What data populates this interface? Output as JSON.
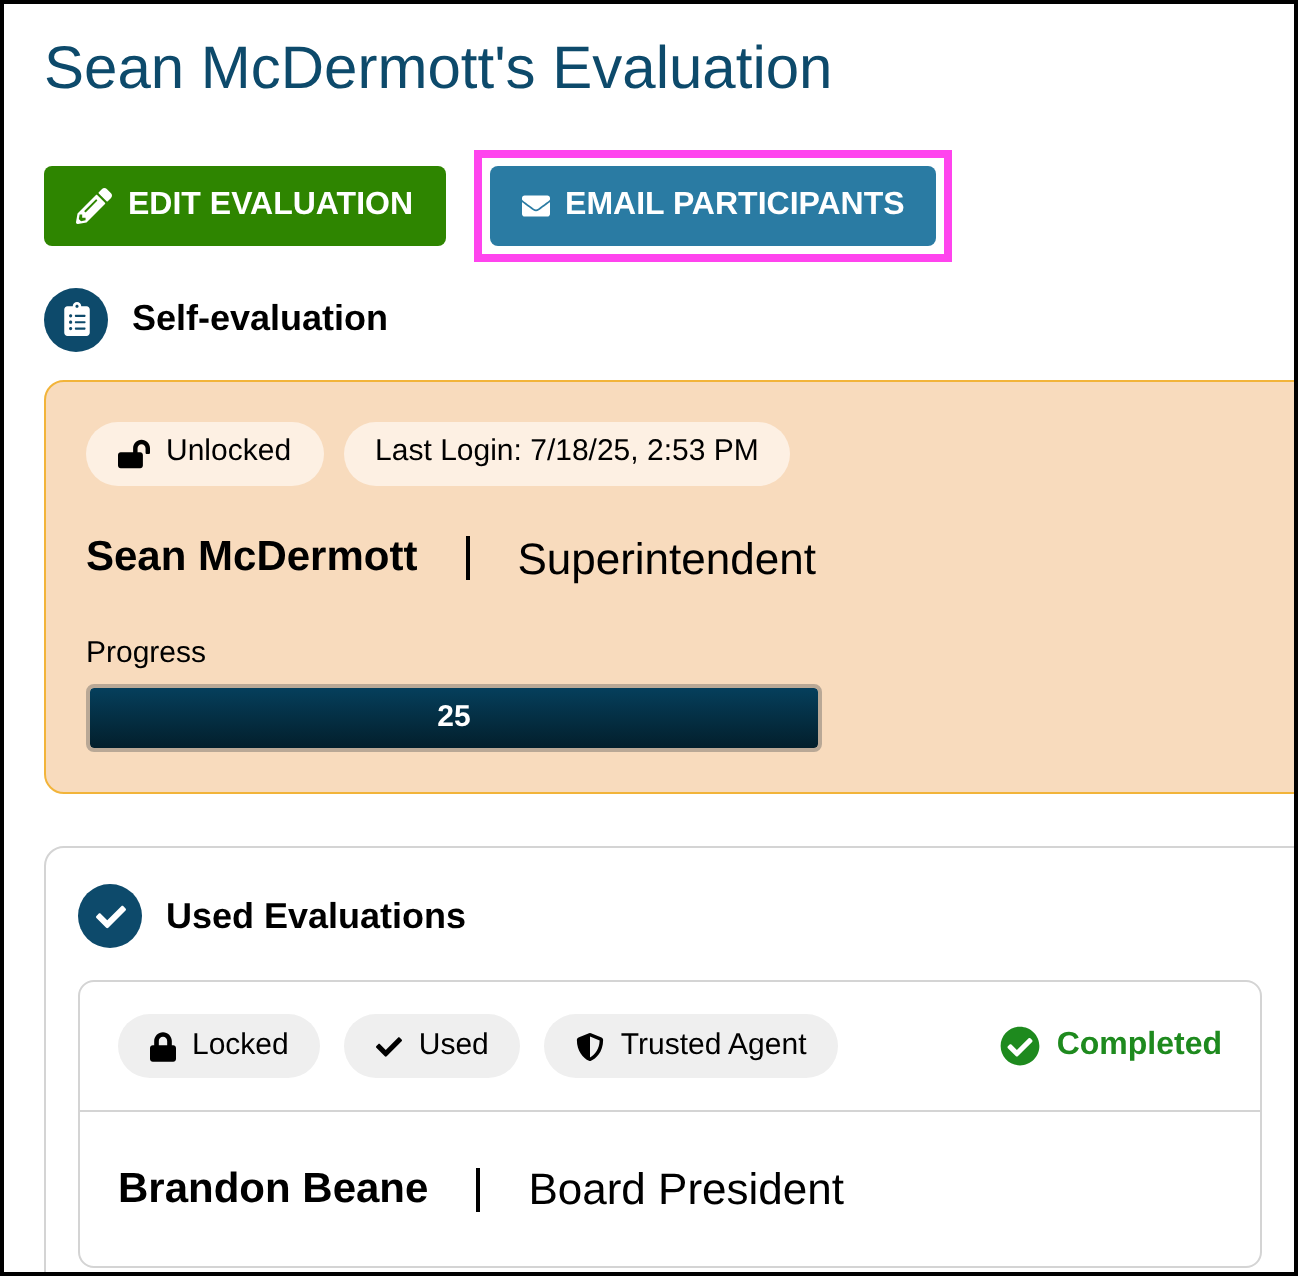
{
  "title": "Sean McDermott's Evaluation",
  "buttons": [
    {
      "kind": "edit",
      "label": "EDIT EVALUATION",
      "highlighted": false
    },
    {
      "kind": "email",
      "label": "EMAIL PARTICIPANTS",
      "highlighted": true
    }
  ],
  "self_evaluation": {
    "heading": "Self-evaluation",
    "tags": [
      {
        "kind": "unlocked",
        "label": "Unlocked"
      },
      {
        "kind": "text",
        "label": "Last Login: 7/18/25, 2:53 PM"
      }
    ],
    "name": "Sean McDermott",
    "role": "Superintendent",
    "progress": {
      "label": "Progress",
      "level": 1,
      "reading": "25"
    }
  },
  "used_evaluations": {
    "heading": "Used Evaluations",
    "items": [
      {
        "tags": [
          {
            "kind": "locked",
            "label": "Locked"
          },
          {
            "kind": "used",
            "label": "Used"
          },
          {
            "kind": "trusted",
            "label": "Trusted Agent"
          }
        ],
        "status": "Completed",
        "name": "Brandon Beane",
        "role": "Board President"
      }
    ]
  }
}
